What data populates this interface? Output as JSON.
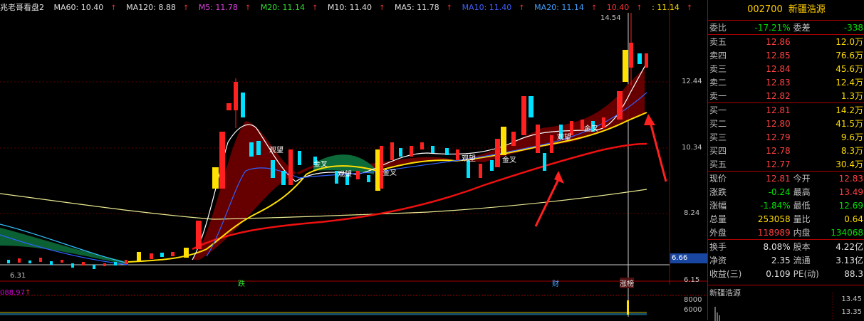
{
  "header": {
    "indicator": "兆老哥看盘2",
    "ma60": "MA60: 10.40",
    "ma120": "MA120: 8.88",
    "m5": "M5: 11.78",
    "m20": "M20: 11.14",
    "m10": "M10: 11.40",
    "ma5": "MA5: 11.78",
    "ma10": "MA10: 11.40",
    "ma20": "MA20: 11.14",
    "v1": "10.40",
    "v2": ": 11.14"
  },
  "axis": {
    "y_labels": [
      "12.44",
      "10.34",
      "8.24",
      "6.15"
    ],
    "current": "6.66",
    "high_mark": "14.54",
    "low_mark": "6.31"
  },
  "events": [
    "跌",
    "财",
    "涨榜"
  ],
  "annotations": [
    "观望",
    "金叉",
    "观望",
    "金叉",
    "观望",
    "金叉",
    "观望",
    "金叉"
  ],
  "volume": {
    "header": "088.97",
    "y_labels": [
      "8000",
      "6000"
    ]
  },
  "quote": {
    "code": "002700",
    "name": "新疆浩源",
    "weibi_label": "委比",
    "weibi_value": "-17.21%",
    "weicha_label": "委差",
    "weicha_value": "-338",
    "asks": [
      {
        "label": "卖五",
        "price": "12.86",
        "vol": "12.0万"
      },
      {
        "label": "卖四",
        "price": "12.85",
        "vol": "76.6万"
      },
      {
        "label": "卖三",
        "price": "12.84",
        "vol": "45.6万"
      },
      {
        "label": "卖二",
        "price": "12.83",
        "vol": "12.4万"
      },
      {
        "label": "卖一",
        "price": "12.82",
        "vol": "1.3万"
      }
    ],
    "bids": [
      {
        "label": "买一",
        "price": "12.81",
        "vol": "14.2万"
      },
      {
        "label": "买二",
        "price": "12.80",
        "vol": "41.5万"
      },
      {
        "label": "买三",
        "price": "12.79",
        "vol": "9.6万"
      },
      {
        "label": "买四",
        "price": "12.78",
        "vol": "8.3万"
      },
      {
        "label": "买五",
        "price": "12.77",
        "vol": "30.4万"
      }
    ],
    "stats": [
      {
        "l1": "现价",
        "v1": "12.81",
        "l2": "今开",
        "v2": "12.83"
      },
      {
        "l1": "涨跌",
        "v1": "-0.24",
        "l2": "最高",
        "v2": "13.49"
      },
      {
        "l1": "涨幅",
        "v1": "-1.84%",
        "l2": "最低",
        "v2": "12.69"
      },
      {
        "l1": "总量",
        "v1": "253058",
        "l2": "量比",
        "v2": "0.64"
      },
      {
        "l1": "外盘",
        "v1": "118989",
        "l2": "内盘",
        "v2": "134068"
      }
    ],
    "fund": [
      {
        "l1": "换手",
        "v1": "8.08%",
        "l2": "股本",
        "v2": "4.22亿"
      },
      {
        "l1": "净资",
        "v1": "2.35",
        "l2": "流通",
        "v2": "3.13亿"
      },
      {
        "l1": "收益(三)",
        "v1": "0.109",
        "l2": "PE(动)",
        "v2": "88.3"
      }
    ]
  },
  "mini": {
    "title": "新疆浩源",
    "y_labels": [
      "13.45",
      "13.35"
    ]
  }
}
